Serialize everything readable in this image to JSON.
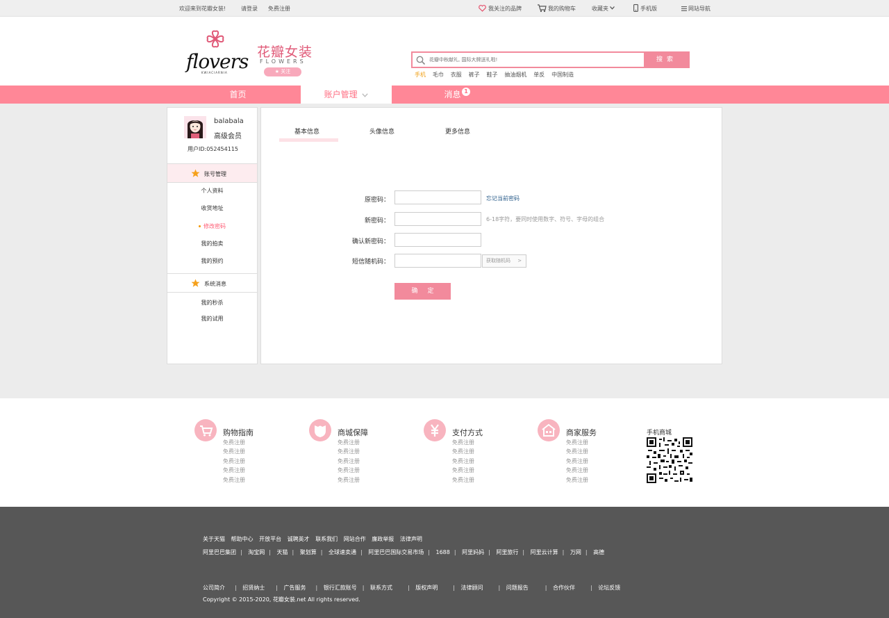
{
  "topbar": {
    "welcome": "欢迎来到花瓣女装!",
    "login": "请登录",
    "register": "免费注册",
    "brands": "我关注的品牌",
    "cart": "我的购物车",
    "favorites": "收藏夹",
    "mobile": "手机版",
    "sitenav": "网站导航"
  },
  "header": {
    "logo_word": "flovers",
    "logo_sub": "KWIACIARNIA",
    "brand_cn": "花瓣女装",
    "brand_en": "FLOWERS",
    "follow": "关注",
    "search_placeholder": "花瓣中秋献礼, 国际大牌送礼啦!",
    "search_button": "搜索",
    "hot": [
      "手机",
      "毛巾",
      "衣服",
      "裤子",
      "鞋子",
      "抽油烟机",
      "单反",
      "中国制造"
    ]
  },
  "nav": {
    "home": "首页",
    "account": "账户管理",
    "messages": "消息",
    "message_count": "1"
  },
  "sidebar": {
    "username": "balabala",
    "level": "高级会员",
    "uid": "用户ID:052454115",
    "section1": "账号管理",
    "items1": [
      "个人资料",
      "收货地址",
      "修改密码",
      "我的拍卖",
      "我的预约"
    ],
    "section2": "系统消息",
    "items2": [
      "我的秒杀",
      "我的试用"
    ]
  },
  "panel": {
    "tabs": [
      "基本信息",
      "头像信息",
      "更多信息"
    ],
    "old_pwd_label": "原密码：",
    "forgot_link": "忘记当前密码",
    "new_pwd_label": "新密码：",
    "new_pwd_hint": "6-18字符，要同时使用数字、符号、字母的组合",
    "confirm_pwd_label": "确认新密码：",
    "sms_label": "短信随机码：",
    "sms_button": "获取随机码",
    "sms_arrow": ">",
    "submit": "确定"
  },
  "service": {
    "columns": [
      {
        "title": "购物指南",
        "links": [
          "免费注册",
          "免费注册",
          "免费注册",
          "免费注册",
          "免费注册"
        ]
      },
      {
        "title": "商城保障",
        "links": [
          "免费注册",
          "免费注册",
          "免费注册",
          "免费注册",
          "免费注册"
        ]
      },
      {
        "title": "支付方式",
        "links": [
          "免费注册",
          "免费注册",
          "免费注册",
          "免费注册",
          "免费注册"
        ]
      },
      {
        "title": "商家服务",
        "links": [
          "免费注册",
          "免费注册",
          "免费注册",
          "免费注册",
          "免费注册"
        ]
      }
    ],
    "qr_title": "手机商城"
  },
  "footer": {
    "row1": [
      "关于天猫",
      "帮助中心",
      "开放平台",
      "诚聘英才",
      "联系我们",
      "网站合作",
      "廉政举报",
      "法律声明"
    ],
    "row2": [
      "阿里巴巴集团",
      "淘宝网",
      "天猫",
      "聚划算",
      "全球速卖通",
      "阿里巴巴国际交易市场",
      "1688",
      "阿里妈妈",
      "阿里旅行",
      "阿里云计算",
      "万网",
      "高德"
    ],
    "row3": [
      "公司简介",
      "招贤纳士",
      "广告服务",
      "银行汇款账号",
      "联系方式",
      "版权声明",
      "法律顾问",
      "问题报告",
      "合作伙伴",
      "论坛反馈"
    ],
    "copyright": "Copyright © 2015-2020, 花瓣女装.net All rights reserved."
  },
  "colors": {
    "accent": "#ff8797",
    "accent_dark": "#e05a78",
    "button": "#f28a9c",
    "footer_bg": "#575757"
  }
}
